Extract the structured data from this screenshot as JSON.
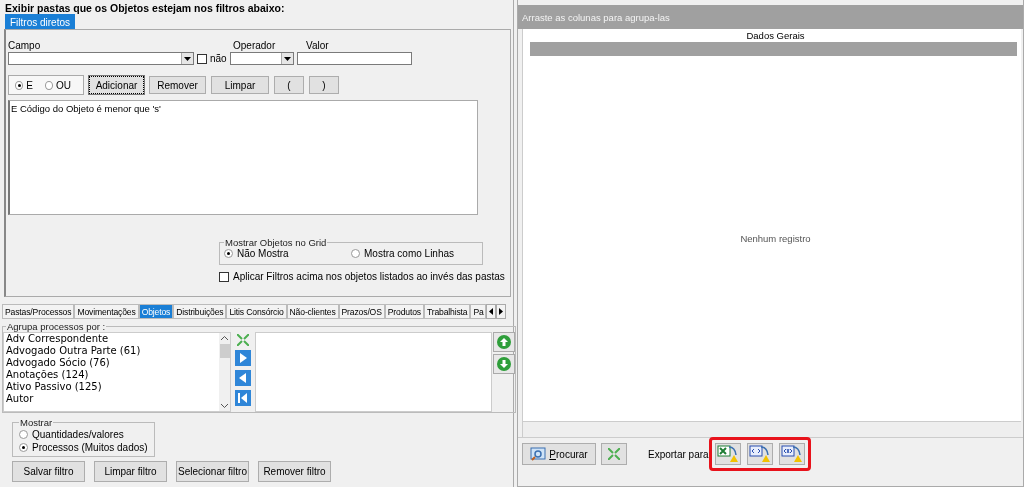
{
  "filter_header": "Exibir pastas que os Objetos estejam nos filtros abaixo:",
  "filter_tabs": [
    {
      "label": "Filtros diretos",
      "selected": true
    }
  ],
  "fields": {
    "campo_label": "Campo",
    "negate": {
      "label": "não",
      "checked": false
    },
    "operador_label": "Operador",
    "valor_label": "Valor"
  },
  "logic": [
    {
      "label": "E",
      "selected": true
    },
    {
      "label": "OU",
      "selected": false
    }
  ],
  "filter_buttons": [
    "Adicionar",
    "Remover",
    "Limpar",
    "(",
    ")"
  ],
  "filter_text": "E Código do Objeto  é menor que 's'",
  "grid_options": {
    "title": "Mostrar Objetos no Grid",
    "options": [
      {
        "label": "Não Mostra",
        "selected": true
      },
      {
        "label": "Mostra como Linhas",
        "selected": false
      }
    ]
  },
  "apply_checkbox": {
    "label": "Aplicar Filtros acima nos objetos listados ao invés das pastas",
    "checked": false
  },
  "section_tabs": [
    {
      "label": "Pastas/Processos",
      "selected": false
    },
    {
      "label": "Movimentações",
      "selected": false
    },
    {
      "label": "Objetos",
      "selected": true
    },
    {
      "label": "Distribuições",
      "selected": false
    },
    {
      "label": "Litis Consórcio",
      "selected": false
    },
    {
      "label": "Não-clientes",
      "selected": false
    },
    {
      "label": "Prazos/OS",
      "selected": false
    },
    {
      "label": "Produtos",
      "selected": false
    },
    {
      "label": "Trabalhista",
      "selected": false
    },
    {
      "label": "Pa",
      "selected": false
    }
  ],
  "group_by": {
    "title": "Agrupa processos por :",
    "items": [
      "Adv Correspondente",
      "Advogado Outra Parte (61)",
      "Advogado Sócio (76)",
      "Anotações (124)",
      "Ativo Passivo (125)",
      "Autor"
    ]
  },
  "show": {
    "title": "Mostrar",
    "options": [
      {
        "label": "Quantidades/valores",
        "selected": false
      },
      {
        "label": "Processos (Muitos dados)",
        "selected": true
      }
    ]
  },
  "bottom_buttons": [
    "Salvar filtro",
    "Limpar filtro",
    "Selecionar filtro",
    "Remover filtro"
  ],
  "grid": {
    "group_hint": "Arraste as colunas para agrupa-las",
    "band": "Dados Gerais",
    "empty": "Nenhum registro"
  },
  "footer": {
    "search": "Procurar",
    "export_label": "Exportar para"
  }
}
